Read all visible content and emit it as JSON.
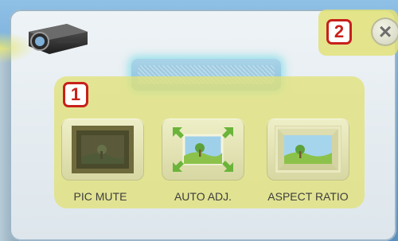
{
  "close_button": {
    "glyph": "×"
  },
  "callouts": {
    "first": "1",
    "second": "2"
  },
  "tiles": [
    {
      "label": "PIC MUTE",
      "icon": "pic-mute-icon"
    },
    {
      "label": "AUTO ADJ.",
      "icon": "auto-adjust-icon"
    },
    {
      "label": "ASPECT RATIO",
      "icon": "aspect-ratio-icon"
    }
  ],
  "colors": {
    "highlight": "#e2e278",
    "badge_border": "#c8201b",
    "panel": "#eef3f6"
  }
}
